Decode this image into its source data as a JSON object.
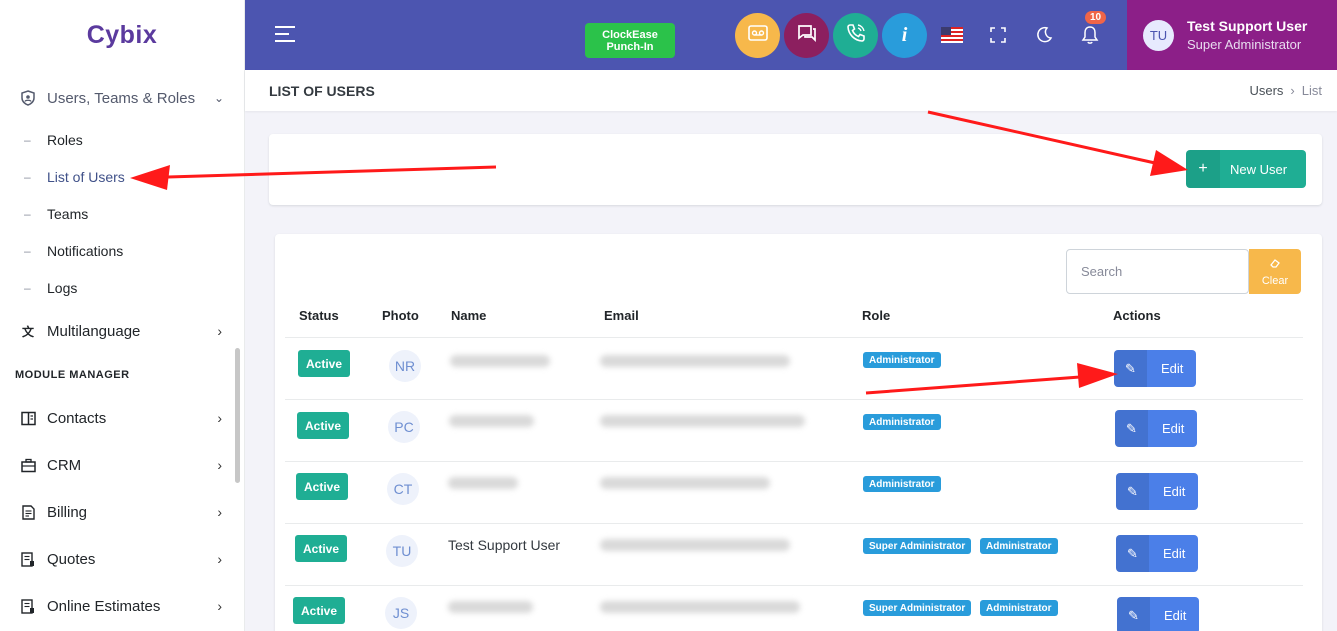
{
  "app": {
    "logo": "Cybix"
  },
  "sidebar": {
    "group": {
      "label": "Users, Teams & Roles",
      "icon": "shield-user-icon"
    },
    "subitems": [
      {
        "label": "Roles",
        "active": false
      },
      {
        "label": "List of Users",
        "active": true
      },
      {
        "label": "Teams",
        "active": false
      },
      {
        "label": "Notifications",
        "active": false
      },
      {
        "label": "Logs",
        "active": false
      }
    ],
    "multilanguage": {
      "label": "Multilanguage",
      "icon": "translate-icon"
    },
    "section_title": "MODULE MANAGER",
    "modules": [
      {
        "label": "Contacts",
        "icon": "contacts-icon"
      },
      {
        "label": "CRM",
        "icon": "briefcase-icon"
      },
      {
        "label": "Billing",
        "icon": "file-invoice-icon"
      },
      {
        "label": "Quotes",
        "icon": "file-list-icon"
      },
      {
        "label": "Online Estimates",
        "icon": "file-estimate-icon"
      }
    ]
  },
  "topbar": {
    "clockease_line1": "ClockEase",
    "clockease_line2": "Punch-In",
    "circle_buttons": [
      {
        "name": "voicemail-icon",
        "color": "#f7b84b"
      },
      {
        "name": "chat-icon",
        "color": "#8c1f5f"
      },
      {
        "name": "phone-icon",
        "color": "#1fae94"
      },
      {
        "name": "info-icon",
        "color": "#299cdb"
      }
    ],
    "notification_count": "10",
    "user": {
      "initials": "TU",
      "name": "Test Support User",
      "role": "Super Administrator"
    }
  },
  "page": {
    "title": "LIST OF USERS",
    "breadcrumb": [
      "Users",
      "List"
    ]
  },
  "toolbar": {
    "new_user_label": "New User",
    "new_user_icon": "+"
  },
  "search": {
    "placeholder": "Search",
    "clear_label": "Clear"
  },
  "table": {
    "columns": [
      "Status",
      "Photo",
      "Name",
      "Email",
      "Role",
      "Actions"
    ],
    "rows": [
      {
        "status": "Active",
        "initials": "NR",
        "name": "",
        "roles": [
          "Administrator"
        ],
        "action": "Edit"
      },
      {
        "status": "Active",
        "initials": "PC",
        "name": "",
        "roles": [
          "Administrator"
        ],
        "action": "Edit"
      },
      {
        "status": "Active",
        "initials": "CT",
        "name": "",
        "roles": [
          "Administrator"
        ],
        "action": "Edit"
      },
      {
        "status": "Active",
        "initials": "TU",
        "name": "Test Support User",
        "roles": [
          "Super Administrator",
          "Administrator"
        ],
        "action": "Edit"
      },
      {
        "status": "Active",
        "initials": "JS",
        "name": "",
        "roles": [
          "Super Administrator",
          "Administrator"
        ],
        "action": "Edit"
      }
    ]
  },
  "colors": {
    "topbar": "#4c55b0",
    "user_area": "#8c1f88",
    "success": "#1fae94",
    "primary": "#4b7fe8",
    "info": "#299cdb",
    "warning": "#f7b84b",
    "annotation": "#ff1a1a"
  }
}
